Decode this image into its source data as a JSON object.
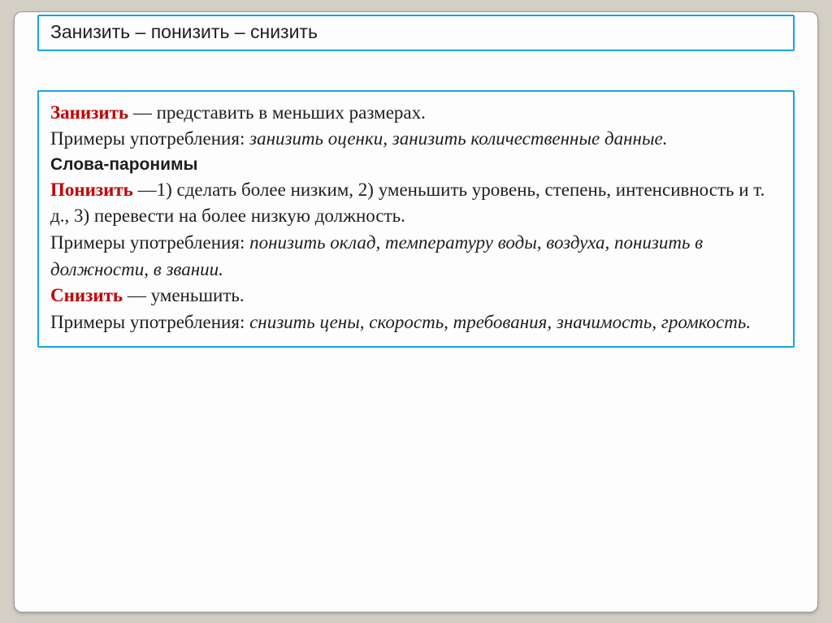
{
  "title": "Занизить – понизить – снизить",
  "entries": {
    "zanizit": {
      "term": "Занизить",
      "definition": " — представить в меньших размерах.",
      "examples_label": "Примеры употребления: ",
      "examples": "занизить оценки, занизить количественные данные."
    },
    "subhead": "Слова-паронимы",
    "ponizit": {
      "term": "Понизить",
      "definition": " —1) сделать более низким, 2) уменьшить уровень, степень, интенсивность и т. д., 3) перевести на более низкую должность.",
      "examples_label": "Примеры употребления: ",
      "examples": "понизить оклад, температуру воды, воздуха, понизить в должности, в звании."
    },
    "snizit": {
      "term": "Снизить",
      "definition": " — уменьшить.",
      "examples_label": "Примеры употребления: ",
      "examples": "снизить цены, скорость, требования, значимость, громкость."
    }
  }
}
